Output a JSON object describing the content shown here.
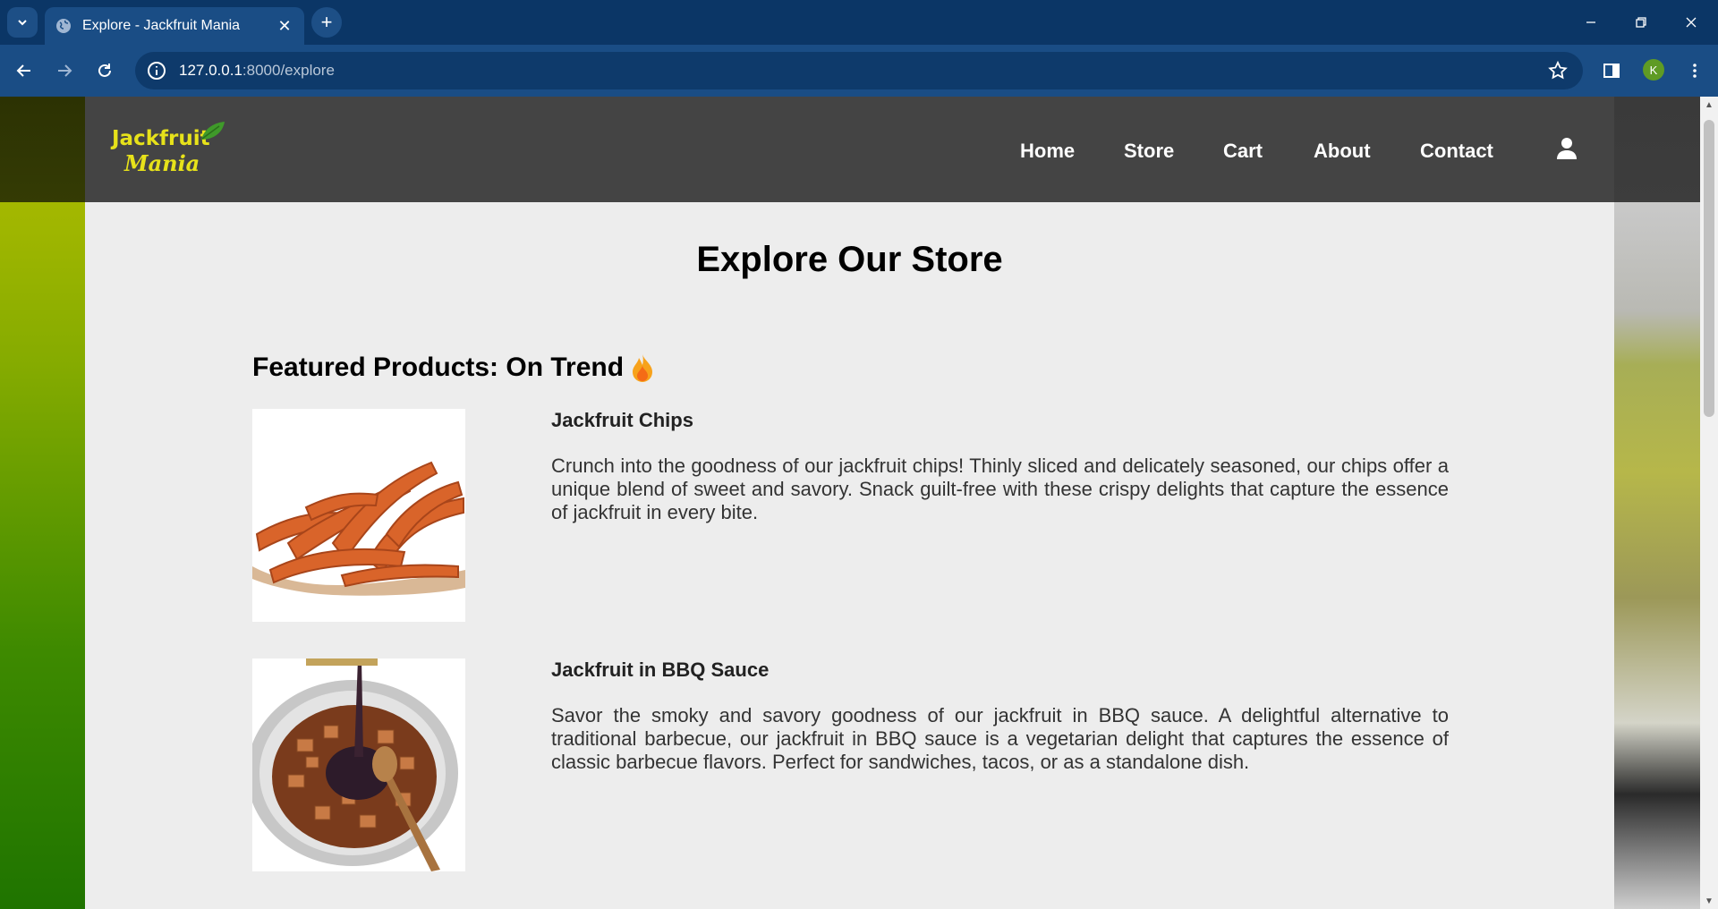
{
  "browser": {
    "tab_title": "Explore - Jackfruit Mania",
    "url_host": "127.0.0.1",
    "url_path": ":8000/explore",
    "profile_initial": "K"
  },
  "site": {
    "logo_line1": "Jackfruit",
    "logo_line2": "Mania",
    "nav": [
      "Home",
      "Store",
      "Cart",
      "About",
      "Contact"
    ],
    "page_title": "Explore Our Store",
    "section_title": "Featured Products: On Trend",
    "products": [
      {
        "name": "Jackfruit Chips",
        "description": "Crunch into the goodness of our jackfruit chips! Thinly sliced and delicately seasoned, our chips offer a unique blend of sweet and savory. Snack guilt-free with these crispy delights that capture the essence of jackfruit in every bite."
      },
      {
        "name": "Jackfruit in BBQ Sauce",
        "description": "Savor the smoky and savory goodness of our jackfruit in BBQ sauce. A delightful alternative to traditional barbecue, our jackfruit in BBQ sauce is a vegetarian delight that captures the essence of classic barbecue flavors. Perfect for sandwiches, tacos, or as a standalone dish."
      }
    ]
  },
  "colors": {
    "browser_frame": "#0b3666",
    "toolbar": "#1a4d85",
    "site_header": "#444444",
    "logo_yellow": "#e7e21a",
    "page_bg": "#ededed"
  }
}
